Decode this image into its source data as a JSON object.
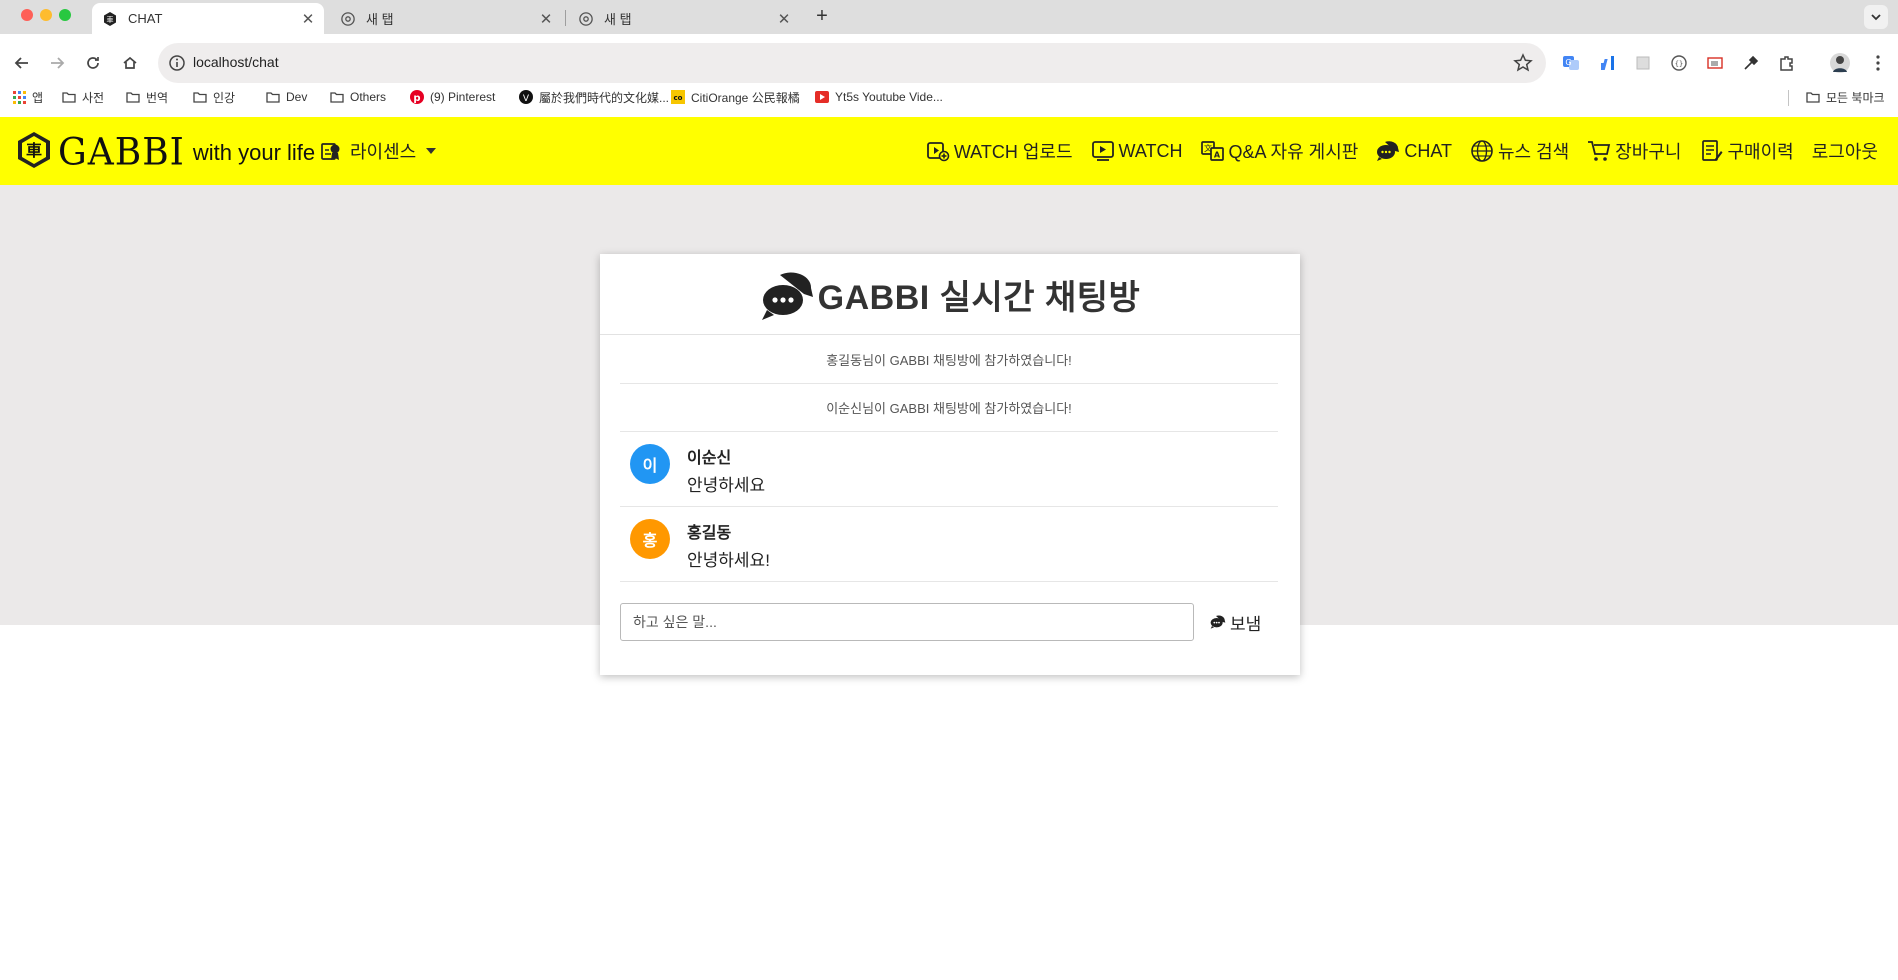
{
  "browser": {
    "tabs": [
      {
        "title": "CHAT",
        "icon": "gabbi-favicon"
      },
      {
        "title": "새 탭",
        "icon": "chrome-icon"
      },
      {
        "title": "새 탭",
        "icon": "chrome-icon"
      }
    ],
    "url": "localhost/chat",
    "bookmarks": [
      {
        "label": "앱",
        "icon": "apps-grid-icon"
      },
      {
        "label": "사전",
        "icon": "folder-icon"
      },
      {
        "label": "번역",
        "icon": "folder-icon"
      },
      {
        "label": "인강",
        "icon": "folder-icon"
      },
      {
        "label": "Dev",
        "icon": "folder-icon"
      },
      {
        "label": "Others",
        "icon": "folder-icon"
      },
      {
        "label": "(9) Pinterest",
        "icon": "pinterest-icon"
      },
      {
        "label": "屬於我們時代的文化媒...",
        "icon": "v-logo-icon"
      },
      {
        "label": "CitiOrange 公民報橘",
        "icon": "co-logo-icon"
      },
      {
        "label": "Yt5s Youtube Vide...",
        "icon": "youtube-icon"
      }
    ],
    "all_bookmarks": "모든 북마크"
  },
  "header": {
    "brand": "GABBI",
    "tagline": "with your life",
    "license_menu": "라이센스",
    "nav": [
      {
        "label": "WATCH 업로드",
        "icon": "video-upload-icon"
      },
      {
        "label": "WATCH",
        "icon": "video-play-icon"
      },
      {
        "label": "Q&A 자유 게시판",
        "icon": "translate-board-icon"
      },
      {
        "label": "CHAT",
        "icon": "chat-bubbles-icon"
      },
      {
        "label": "뉴스 검색",
        "icon": "globe-icon"
      },
      {
        "label": "장바구니",
        "icon": "cart-icon"
      },
      {
        "label": "구매이력",
        "icon": "receipt-icon"
      },
      {
        "label": "로그아웃",
        "icon": ""
      }
    ]
  },
  "chat": {
    "title": "GABBI 실시간 채팅방",
    "system_messages": [
      "홍길동님이 GABBI 채팅방에 참가하였습니다!",
      "이순신님이 GABBI 채팅방에 참가하였습니다!"
    ],
    "messages": [
      {
        "initial": "이",
        "name": "이순신",
        "text": "안녕하세요",
        "color": "#2196f3"
      },
      {
        "initial": "홍",
        "name": "홍길동",
        "text": "안녕하세요!",
        "color": "#ff9800"
      }
    ],
    "input_placeholder": "하고 싶은 말...",
    "send_label": "보냄"
  },
  "colors": {
    "header_bg": "#ffff00",
    "page_bg": "#ebe9e9"
  }
}
